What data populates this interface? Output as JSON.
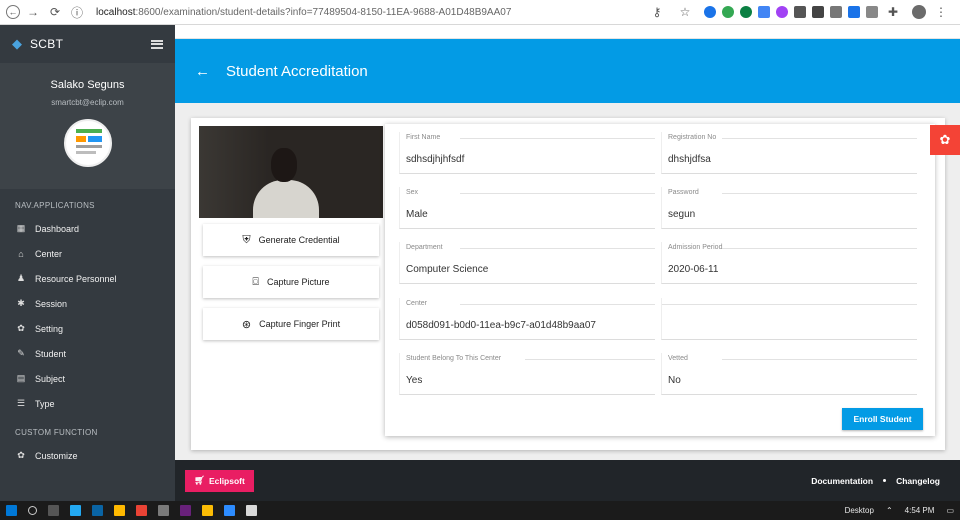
{
  "browser": {
    "url_host": "localhost",
    "url_rest": ":8600/examination/student-details?info=77489504-8150-11EA-9688-A01D48B9AA07"
  },
  "sidebar": {
    "brand": "SCBT",
    "user_name": "Salako Seguns",
    "user_email": "smartcbt@eclip.com",
    "section_apps": "NAV.APPLICATIONS",
    "items": [
      {
        "label": "Dashboard",
        "icon": "dashboard-icon"
      },
      {
        "label": "Center",
        "icon": "home-icon"
      },
      {
        "label": "Resource Personnel",
        "icon": "person-icon"
      },
      {
        "label": "Session",
        "icon": "settings-icon"
      },
      {
        "label": "Setting",
        "icon": "gear-icon"
      },
      {
        "label": "Student",
        "icon": "student-icon"
      },
      {
        "label": "Subject",
        "icon": "book-icon"
      },
      {
        "label": "Type",
        "icon": "list-icon"
      }
    ],
    "section_custom": "CUSTOM FUNCTION",
    "custom_items": [
      {
        "label": "Customize",
        "icon": "gear-icon"
      }
    ]
  },
  "header": {
    "title": "Student Accreditation"
  },
  "actions": {
    "generate": "Generate Credential",
    "capture_picture": "Capture Picture",
    "capture_finger": "Capture Finger Print"
  },
  "form": {
    "first_name": {
      "label": "First Name",
      "value": "sdhsdjhjhfsdf"
    },
    "registration_no": {
      "label": "Registration No",
      "value": "dhshjdfsa"
    },
    "sex": {
      "label": "Sex",
      "value": "Male"
    },
    "password": {
      "label": "Password",
      "value": "segun"
    },
    "department": {
      "label": "Department",
      "value": "Computer Science"
    },
    "admission_period": {
      "label": "Admission Period",
      "value": "2020-06-11"
    },
    "center": {
      "label": "Center",
      "value": "d058d091-b0d0-11ea-b9c7-a01d48b9aa07"
    },
    "belong": {
      "label": "Student Belong To This Center",
      "value": "Yes"
    },
    "vetted": {
      "label": "Vetted",
      "value": "No"
    },
    "enroll_label": "Enroll Student"
  },
  "footer": {
    "brand_label": "Eclipsoft",
    "documentation": "Documentation",
    "changelog": "Changelog"
  },
  "taskbar": {
    "desktop": "Desktop",
    "time": "4:54 PM"
  },
  "colors": {
    "primary": "#039be5",
    "sidebar": "#343a40",
    "accent": "#e91e63",
    "danger": "#f44336"
  }
}
